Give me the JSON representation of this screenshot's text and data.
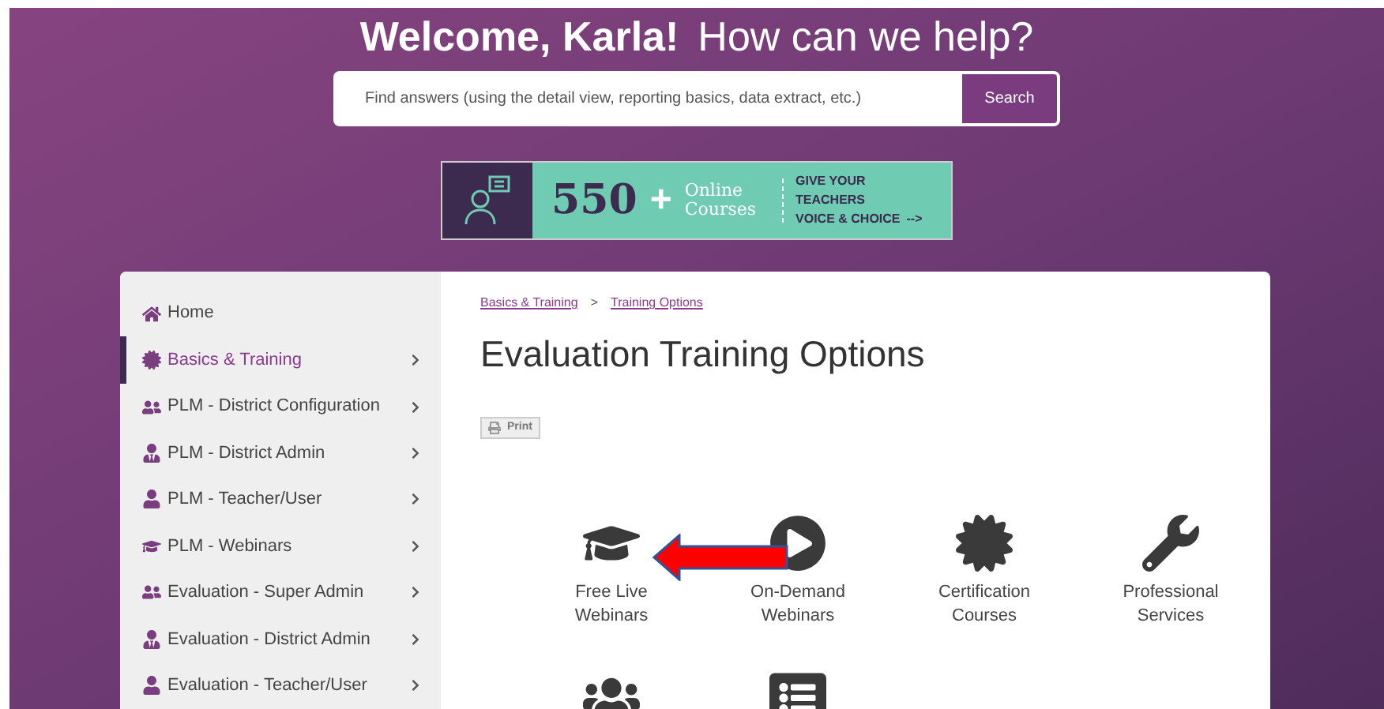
{
  "hero": {
    "greeting": "Welcome, Karla!",
    "question": "How can we help?"
  },
  "search": {
    "placeholder": "Find answers (using the detail view, reporting basics, data extract, etc.)",
    "button": "Search"
  },
  "banner": {
    "count": "550",
    "plus": "+",
    "line1": "Online",
    "line2": "Courses",
    "cta1": "GIVE YOUR TEACHERS",
    "cta2": "VOICE & CHOICE",
    "arrow": "-->"
  },
  "sidebar": {
    "items": [
      {
        "label": "Home",
        "kind": "home",
        "selected": false,
        "chevron": false
      },
      {
        "label": "Basics & Training",
        "kind": "badge",
        "selected": true,
        "chevron": true
      },
      {
        "label": "PLM - District Configuration",
        "kind": "users",
        "selected": false,
        "chevron": true
      },
      {
        "label": "PLM - District Admin",
        "kind": "admin",
        "selected": false,
        "chevron": true
      },
      {
        "label": "PLM - Teacher/User",
        "kind": "user",
        "selected": false,
        "chevron": true
      },
      {
        "label": "PLM - Webinars",
        "kind": "cap",
        "selected": false,
        "chevron": true
      },
      {
        "label": "Evaluation - Super Admin",
        "kind": "users",
        "selected": false,
        "chevron": true
      },
      {
        "label": "Evaluation - District Admin",
        "kind": "admin",
        "selected": false,
        "chevron": true
      },
      {
        "label": "Evaluation - Teacher/User",
        "kind": "user",
        "selected": false,
        "chevron": true
      }
    ]
  },
  "breadcrumb": [
    {
      "label": "Basics & Training"
    },
    {
      "label": "Training Options"
    }
  ],
  "breadcrumb_separator": ">",
  "page_title": "Evaluation Training Options",
  "print_button": "Print",
  "options": [
    {
      "kind": "cap",
      "line1": "Free Live",
      "line2": "Webinars"
    },
    {
      "kind": "play",
      "line1": "On-Demand",
      "line2": "Webinars"
    },
    {
      "kind": "badge",
      "line1": "Certification",
      "line2": "Courses"
    },
    {
      "kind": "wrench",
      "line1": "Professional",
      "line2": "Services"
    },
    {
      "kind": "group"
    },
    {
      "kind": "list"
    }
  ]
}
